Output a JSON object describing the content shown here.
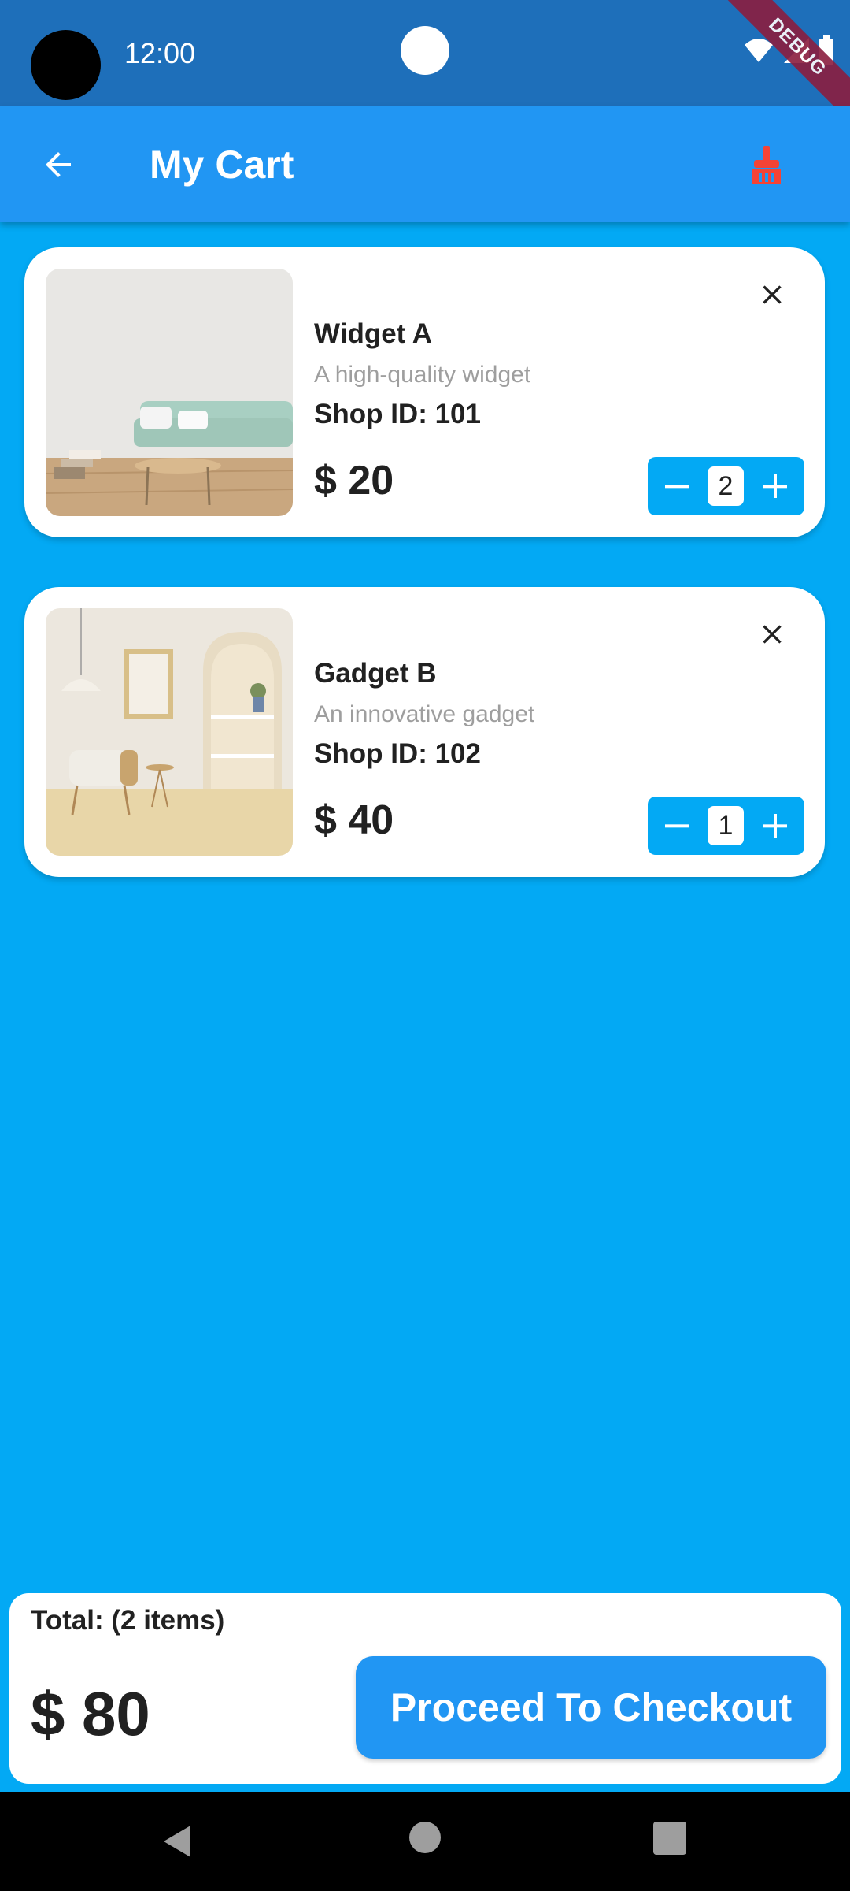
{
  "status_bar": {
    "time": "12:00",
    "debug_banner": "DEBUG",
    "icons": [
      "wifi-icon",
      "signal-icon",
      "battery-icon"
    ]
  },
  "app_bar": {
    "title": "My Cart",
    "back_icon": "arrow-back-icon",
    "action_icon": "cleaning-brush-icon"
  },
  "cart": {
    "items": [
      {
        "name": "Widget A",
        "description": "A high-quality widget",
        "shop": "Shop ID: 101",
        "price": "$ 20",
        "quantity": "2",
        "image": "living-room-sofa-image"
      },
      {
        "name": "Gadget B",
        "description": "An innovative gadget",
        "shop": "Shop ID: 102",
        "price": "$ 40",
        "quantity": "1",
        "image": "arched-room-armchair-image"
      }
    ]
  },
  "summary": {
    "total_label": "Total: (2 items)",
    "total_value": "$ 80",
    "checkout_label": "Proceed To Checkout"
  },
  "colors": {
    "background": "#03A9F4",
    "app_bar": "#2196F3",
    "status_bar": "#1E6FBA",
    "accent_icon": "#F44336"
  }
}
